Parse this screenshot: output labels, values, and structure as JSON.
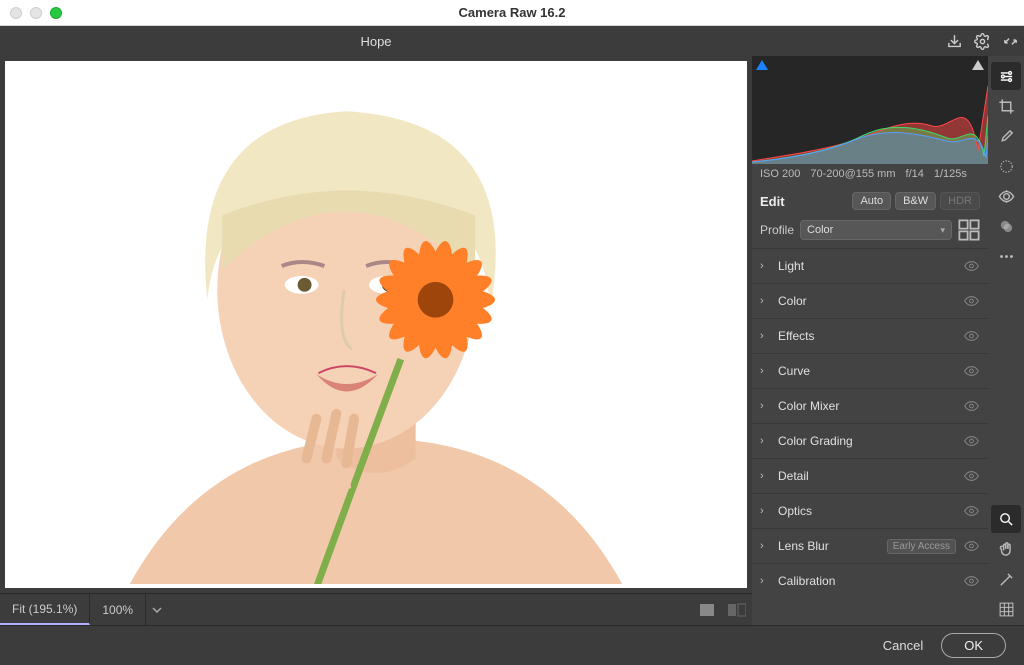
{
  "app_title": "Camera Raw 16.2",
  "document_name": "Hope",
  "exif": {
    "iso": "ISO 200",
    "lens": "70-200@155 mm",
    "aperture": "f/14",
    "shutter": "1/125s"
  },
  "edit": {
    "title": "Edit",
    "auto": "Auto",
    "bw": "B&W",
    "hdr": "HDR"
  },
  "profile": {
    "label": "Profile",
    "value": "Color"
  },
  "panels": [
    {
      "name": "Light"
    },
    {
      "name": "Color"
    },
    {
      "name": "Effects"
    },
    {
      "name": "Curve"
    },
    {
      "name": "Color Mixer"
    },
    {
      "name": "Color Grading"
    },
    {
      "name": "Detail"
    },
    {
      "name": "Optics"
    },
    {
      "name": "Lens Blur",
      "badge": "Early Access"
    },
    {
      "name": "Calibration"
    }
  ],
  "zoom": {
    "fit": "Fit (195.1%)",
    "hundred": "100%"
  },
  "buttons": {
    "cancel": "Cancel",
    "ok": "OK"
  }
}
